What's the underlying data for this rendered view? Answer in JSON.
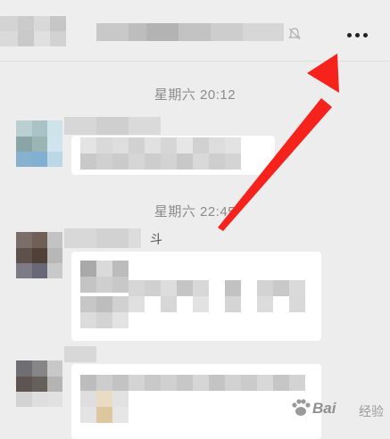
{
  "header": {
    "more_icon": "more-dots-icon",
    "mute_icon": "mute-bell-icon"
  },
  "chat": {
    "timestamps": [
      "星期六 20:12",
      "星期六 22:45"
    ],
    "sender_fragment": "斗"
  },
  "watermark": {
    "brand": "Bai",
    "sub": "经验"
  },
  "annotation": {
    "arrow_color": "#f5231c"
  }
}
